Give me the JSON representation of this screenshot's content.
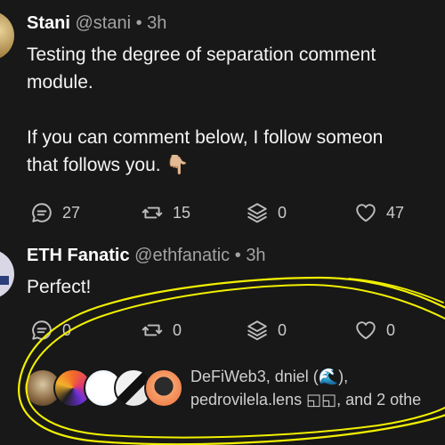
{
  "posts": [
    {
      "author": "Stani",
      "handle": "@stani",
      "separator": "•",
      "time": "3h",
      "body_lines": [
        "Testing the degree of separation comment",
        "module.",
        "",
        "If you can comment below, I follow someon",
        "that follows you. 👇🏼"
      ],
      "stats": {
        "comments": "27",
        "mirrors": "15",
        "collects": "0",
        "likes": "47"
      }
    },
    {
      "author": "ETH Fanatic",
      "handle": "@ethfanatic",
      "separator": "•",
      "time": "3h",
      "body_lines": [
        "Perfect!"
      ],
      "stats": {
        "comments": "0",
        "mirrors": "0",
        "collects": "0",
        "likes": "0"
      }
    }
  ],
  "collectors": {
    "line1": "DeFiWeb3, dniel (🌊),",
    "line2": "pedrovilela.lens ◱◱, and 2 othe"
  },
  "colors": {
    "background": "#181818",
    "text": "#f2f2f2",
    "muted": "#a3a3a3",
    "highlight_scribble": "#f2f000"
  },
  "icons": [
    "comment-icon",
    "mirror-icon",
    "collect-icon",
    "heart-icon"
  ]
}
